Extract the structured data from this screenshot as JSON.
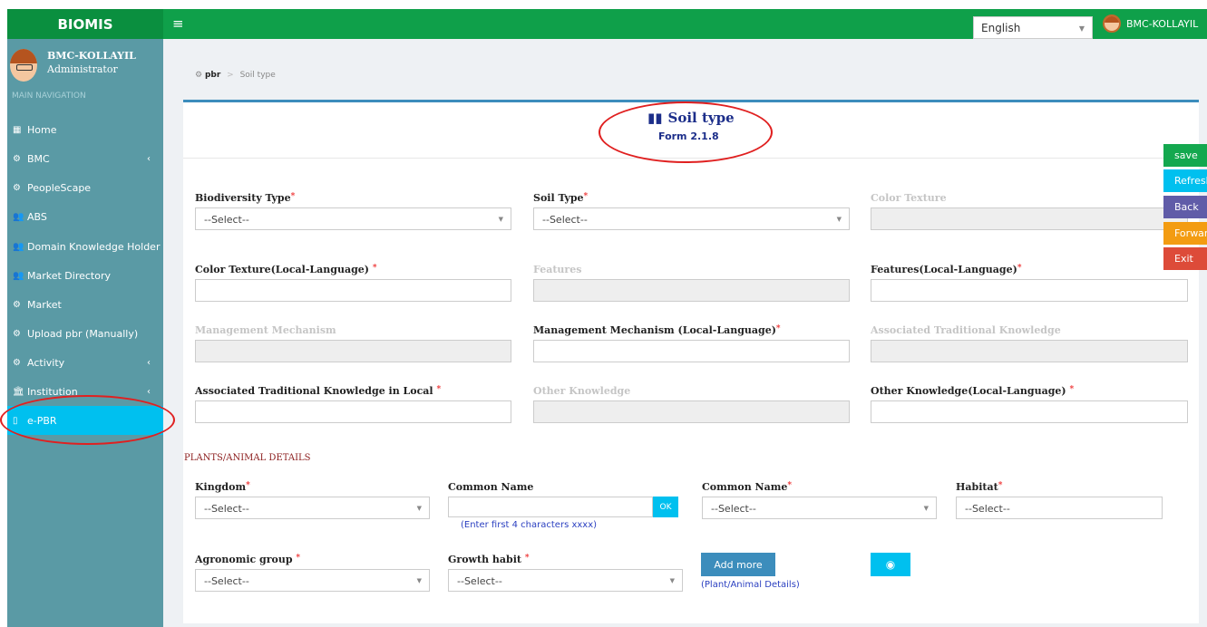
{
  "app": {
    "logo_text": "BIOMIS",
    "menu_icon": "hamburger-icon"
  },
  "header": {
    "language": "English",
    "user_label": "BMC-KOLLAYIL"
  },
  "sidebar": {
    "user": {
      "name": "BMC-KOLLAYIL",
      "role": "Administrator"
    },
    "nav_header": "MAIN NAVIGATION",
    "items": [
      {
        "label": "Home",
        "icon": "grid-icon",
        "glyph": "▦",
        "has_children": false
      },
      {
        "label": "BMC",
        "icon": "gear-icon",
        "glyph": "⚙",
        "has_children": true
      },
      {
        "label": "PeopleScape",
        "icon": "gear-icon",
        "glyph": "⚙",
        "has_children": false
      },
      {
        "label": "ABS",
        "icon": "users-icon",
        "glyph": "👥",
        "has_children": false
      },
      {
        "label": "Domain Knowledge Holder",
        "icon": "users-icon",
        "glyph": "👥",
        "has_children": false
      },
      {
        "label": "Market Directory",
        "icon": "users-icon",
        "glyph": "👥",
        "has_children": false
      },
      {
        "label": "Market",
        "icon": "gear-icon",
        "glyph": "⚙",
        "has_children": false
      },
      {
        "label": "Upload pbr (Manually)",
        "icon": "gear-icon",
        "glyph": "⚙",
        "has_children": false
      },
      {
        "label": "Activity",
        "icon": "gear-icon",
        "glyph": "⚙",
        "has_children": true
      },
      {
        "label": "Institution",
        "icon": "institution-icon",
        "glyph": "🏛",
        "has_children": true
      },
      {
        "label": "e-PBR",
        "icon": "mobile-icon",
        "glyph": "▯",
        "has_children": false,
        "active": true
      }
    ]
  },
  "breadcrumb": {
    "root": "pbr",
    "separator": ">",
    "current": "Soil type"
  },
  "form": {
    "title": "Soil type",
    "title_icon": "map-icon",
    "subtitle": "Form 2.1.8",
    "select_placeholder": "--Select--",
    "labels": {
      "biodiversity_type": "Biodiversity Type",
      "soil_type": "Soil Type",
      "color_texture": "Color Texture",
      "color_texture_local": "Color Texture(Local-Language)",
      "features": "Features",
      "features_local": "Features(Local-Language)",
      "management_mechanism": "Management Mechanism",
      "management_mechanism_local": "Management Mechanism (Local-Language)",
      "assoc_trad_knowledge": "Associated Traditional Knowledge",
      "assoc_trad_knowledge_local": "Associated Traditional Knowledge in Local",
      "other_knowledge": "Other Knowledge",
      "other_knowledge_local": "Other Knowledge(Local-Language)"
    },
    "required_mark": "*"
  },
  "plants": {
    "section_title": "PLANTS/ANIMAL DETAILS",
    "labels": {
      "kingdom": "Kingdom",
      "common_name_search": "Common Name",
      "common_name": "Common Name",
      "habitat": "Habitat",
      "agronomic_group": "Agronomic group",
      "growth_habit": "Growth habit"
    },
    "ok_label": "OK",
    "search_hint": "(Enter first 4 characters xxxx)",
    "add_more_label": "Add more",
    "add_more_hint": "(Plant/Animal Details)",
    "view_icon": "eye-icon"
  },
  "actions": {
    "save": "save",
    "refresh": "Refresh",
    "back": "Back",
    "forward": "Forward",
    "exit": "Exit"
  },
  "colors": {
    "topbar": "#0fa04a",
    "sidebar": "#5a9aa5",
    "active_nav": "#00c0ef",
    "save": "#14a84f",
    "refresh": "#00c0ef",
    "back": "#605ca8",
    "forward": "#f39c12",
    "exit": "#dd4b39",
    "annotation": "#e02020"
  }
}
